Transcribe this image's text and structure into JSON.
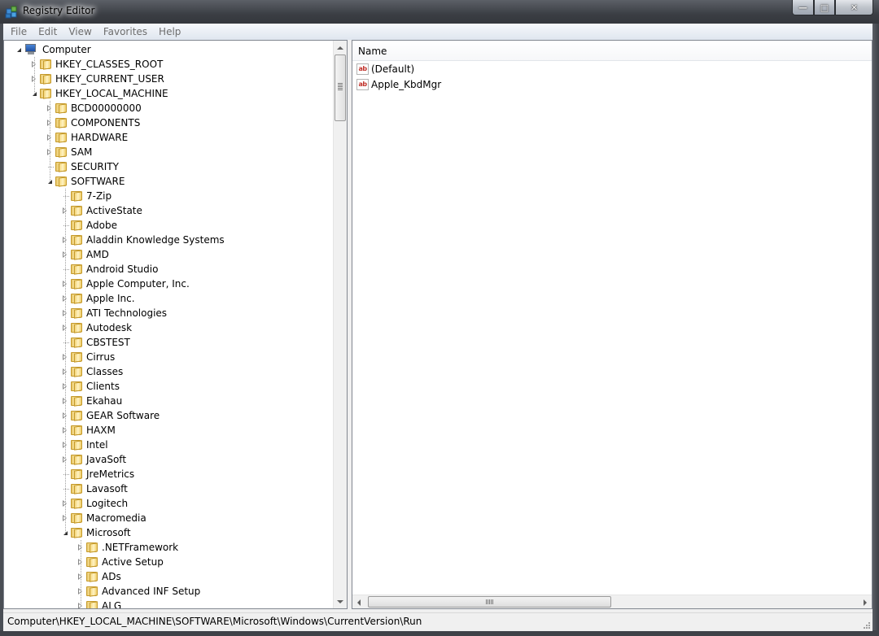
{
  "window": {
    "title": "Registry Editor",
    "buttons": {
      "minimize": "—",
      "maximize": "□",
      "close": "✕"
    }
  },
  "menu": [
    "File",
    "Edit",
    "View",
    "Favorites",
    "Help"
  ],
  "tree": [
    {
      "label": "Computer",
      "depth": 0,
      "state": "open",
      "icon": "computer-icon"
    },
    {
      "label": "HKEY_CLASSES_ROOT",
      "depth": 1,
      "state": "closed"
    },
    {
      "label": "HKEY_CURRENT_USER",
      "depth": 1,
      "state": "closed"
    },
    {
      "label": "HKEY_LOCAL_MACHINE",
      "depth": 1,
      "state": "open"
    },
    {
      "label": "BCD00000000",
      "depth": 2,
      "state": "closed"
    },
    {
      "label": "COMPONENTS",
      "depth": 2,
      "state": "closed"
    },
    {
      "label": "HARDWARE",
      "depth": 2,
      "state": "closed"
    },
    {
      "label": "SAM",
      "depth": 2,
      "state": "closed"
    },
    {
      "label": "SECURITY",
      "depth": 2,
      "state": "none"
    },
    {
      "label": "SOFTWARE",
      "depth": 2,
      "state": "open"
    },
    {
      "label": "7-Zip",
      "depth": 3,
      "state": "none"
    },
    {
      "label": "ActiveState",
      "depth": 3,
      "state": "closed"
    },
    {
      "label": "Adobe",
      "depth": 3,
      "state": "none"
    },
    {
      "label": "Aladdin Knowledge Systems",
      "depth": 3,
      "state": "closed"
    },
    {
      "label": "AMD",
      "depth": 3,
      "state": "closed"
    },
    {
      "label": "Android Studio",
      "depth": 3,
      "state": "none"
    },
    {
      "label": "Apple Computer, Inc.",
      "depth": 3,
      "state": "closed"
    },
    {
      "label": "Apple Inc.",
      "depth": 3,
      "state": "closed"
    },
    {
      "label": "ATI Technologies",
      "depth": 3,
      "state": "closed"
    },
    {
      "label": "Autodesk",
      "depth": 3,
      "state": "closed"
    },
    {
      "label": "CBSTEST",
      "depth": 3,
      "state": "none"
    },
    {
      "label": "Cirrus",
      "depth": 3,
      "state": "closed"
    },
    {
      "label": "Classes",
      "depth": 3,
      "state": "closed"
    },
    {
      "label": "Clients",
      "depth": 3,
      "state": "closed"
    },
    {
      "label": "Ekahau",
      "depth": 3,
      "state": "closed"
    },
    {
      "label": "GEAR Software",
      "depth": 3,
      "state": "closed"
    },
    {
      "label": "HAXM",
      "depth": 3,
      "state": "closed"
    },
    {
      "label": "Intel",
      "depth": 3,
      "state": "closed"
    },
    {
      "label": "JavaSoft",
      "depth": 3,
      "state": "closed"
    },
    {
      "label": "JreMetrics",
      "depth": 3,
      "state": "none"
    },
    {
      "label": "Lavasoft",
      "depth": 3,
      "state": "none"
    },
    {
      "label": "Logitech",
      "depth": 3,
      "state": "closed"
    },
    {
      "label": "Macromedia",
      "depth": 3,
      "state": "closed"
    },
    {
      "label": "Microsoft",
      "depth": 3,
      "state": "open"
    },
    {
      "label": ".NETFramework",
      "depth": 4,
      "state": "closed"
    },
    {
      "label": "Active Setup",
      "depth": 4,
      "state": "closed"
    },
    {
      "label": "ADs",
      "depth": 4,
      "state": "closed"
    },
    {
      "label": "Advanced INF Setup",
      "depth": 4,
      "state": "closed"
    },
    {
      "label": "ALG",
      "depth": 4,
      "state": "closed"
    }
  ],
  "values_pane": {
    "column_name": "Name",
    "rows": [
      {
        "name": "(Default)",
        "icon": "reg-sz-icon"
      },
      {
        "name": "Apple_KbdMgr",
        "icon": "reg-sz-icon"
      }
    ],
    "icon_text": "ab"
  },
  "status": {
    "path": "Computer\\HKEY_LOCAL_MACHINE\\SOFTWARE\\Microsoft\\Windows\\CurrentVersion\\Run"
  },
  "colors": {
    "titlebar": "#3b3e44",
    "menubar": "#dfe6ef",
    "folder": "#e9c76a",
    "reg_sz_icon": "#c0322b"
  }
}
